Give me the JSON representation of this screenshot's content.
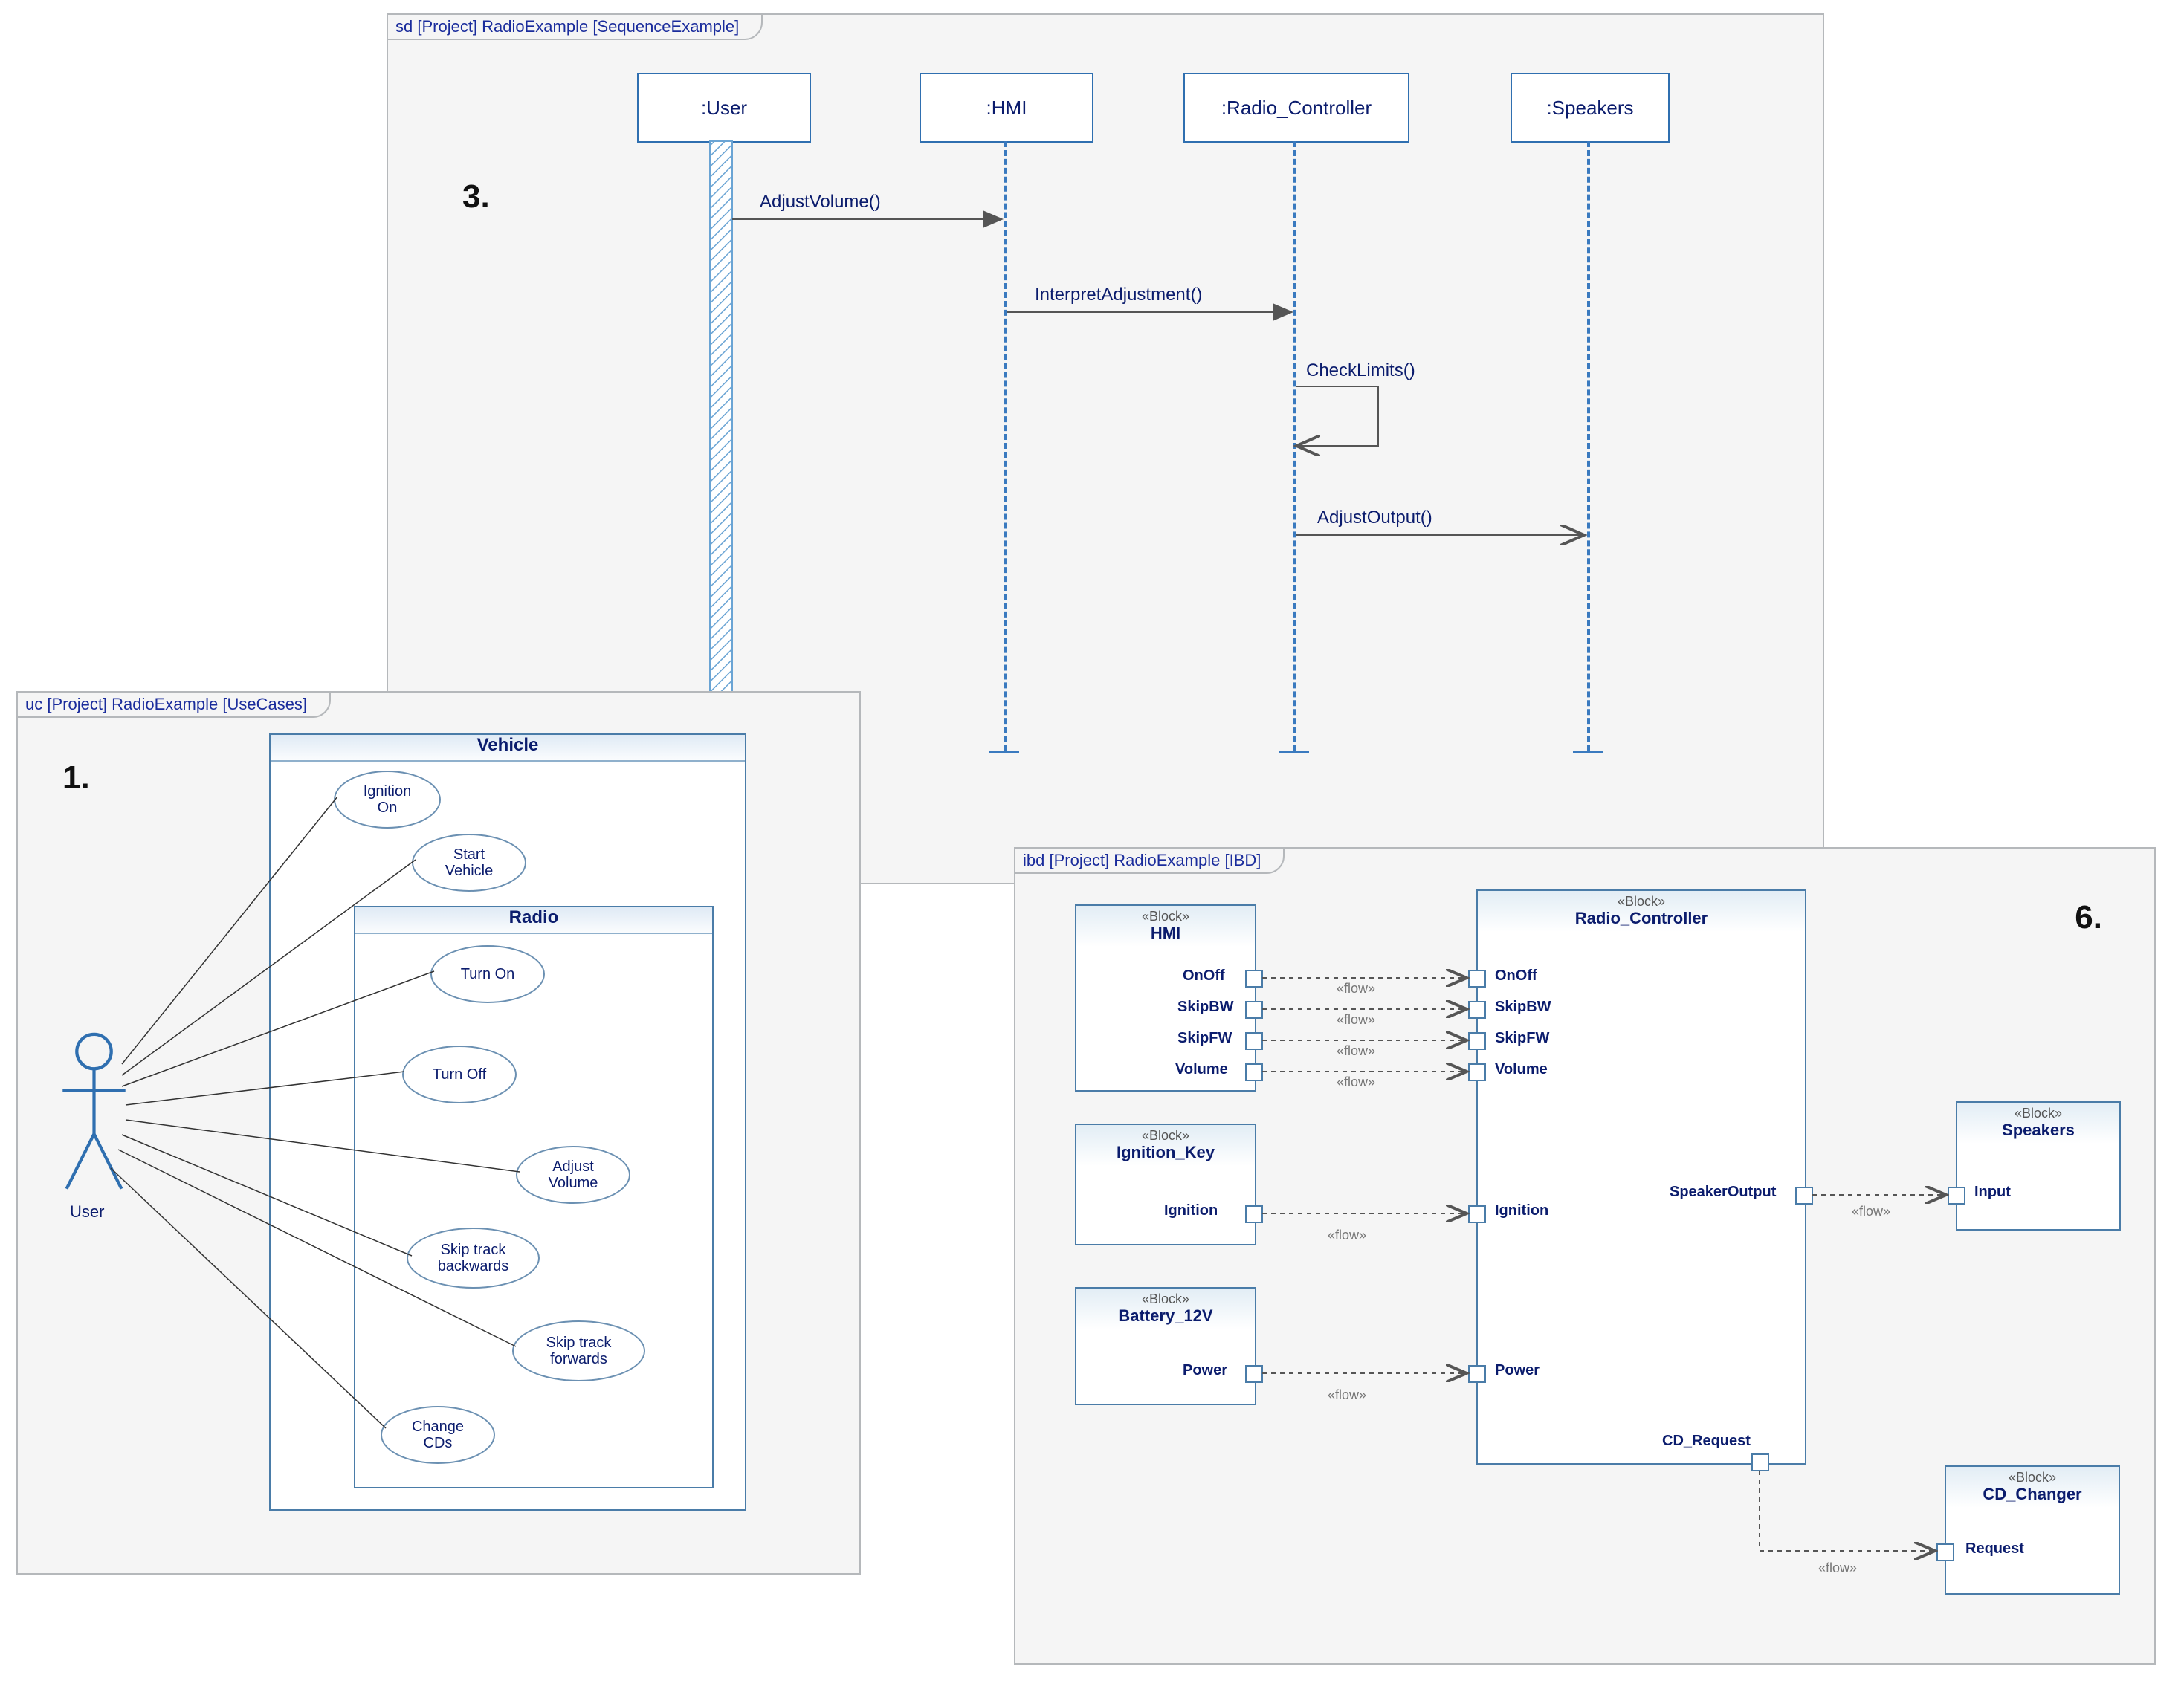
{
  "sd": {
    "tab": "sd [Project] RadioExample [SequenceExample]",
    "number": "3.",
    "lifelines": {
      "user": ":User",
      "hmi": ":HMI",
      "radio": ":Radio_Controller",
      "spk": ":Speakers"
    },
    "messages": {
      "adjustVolume": "AdjustVolume()",
      "interpretAdj": "InterpretAdjustment()",
      "checkLimits": "CheckLimits()",
      "adjustOutput": "AdjustOutput()"
    }
  },
  "uc": {
    "tab": "uc [Project] RadioExample [UseCases]",
    "number": "1.",
    "actor": "User",
    "vehicle": "Vehicle",
    "radio": "Radio",
    "uc1": "Ignition\nOn",
    "uc2": "Start\nVehicle",
    "uc3": "Turn On",
    "uc4": "Turn Off",
    "uc5": "Adjust\nVolume",
    "uc6": "Skip track\nbackwards",
    "uc7": "Skip track\nforwards",
    "uc8": "Change\nCDs"
  },
  "ibd": {
    "tab": "ibd [Project] RadioExample [IBD]",
    "number": "6.",
    "stereo": "«Block»",
    "flow": "«flow»",
    "blocks": {
      "hmi": "HMI",
      "ign": "Ignition_Key",
      "batt": "Battery_12V",
      "rc": "Radio_Controller",
      "spk": "Speakers",
      "cd": "CD_Changer"
    },
    "ports": {
      "onoff": "OnOff",
      "skipbw": "SkipBW",
      "skipfw": "SkipFW",
      "volume": "Volume",
      "ignition": "Ignition",
      "power": "Power",
      "spkout": "SpeakerOutput",
      "input": "Input",
      "cdreq": "CD_Request",
      "request": "Request"
    }
  }
}
